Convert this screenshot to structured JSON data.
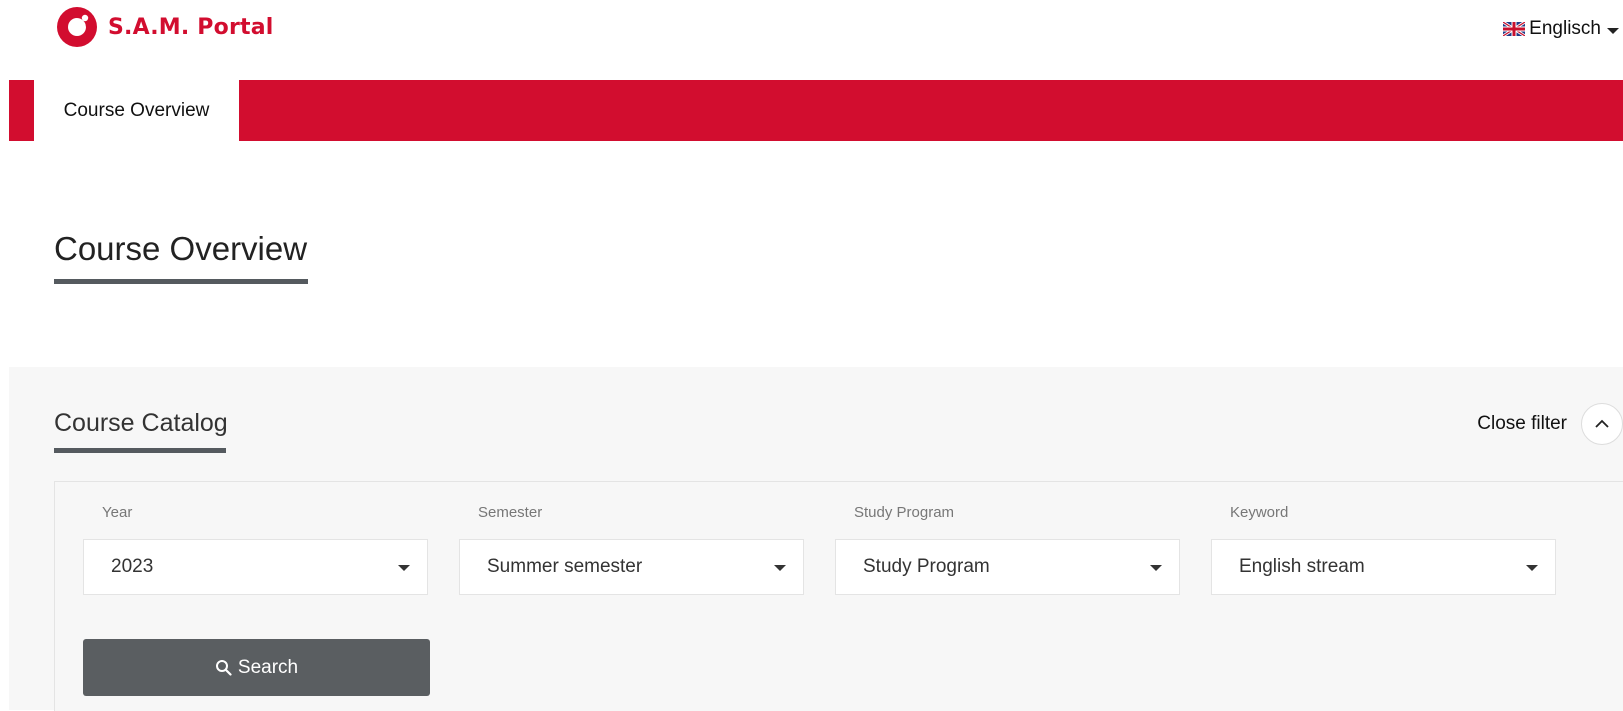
{
  "header": {
    "logo_text": "S.A.M. Portal",
    "language": "Englisch"
  },
  "nav": {
    "tabs": [
      {
        "label": "Course Overview",
        "active": true
      }
    ]
  },
  "page": {
    "title": "Course Overview"
  },
  "filter": {
    "section_title": "Course Catalog",
    "close_label": "Close filter",
    "fields": [
      {
        "label": "Year",
        "value": "2023"
      },
      {
        "label": "Semester",
        "value": "Summer semester"
      },
      {
        "label": "Study Program",
        "value": "Study Program"
      },
      {
        "label": "Keyword",
        "value": "English stream"
      }
    ],
    "search_label": "Search"
  },
  "colors": {
    "brand_red": "#d20d2f",
    "button_gray": "#5a5e61",
    "panel_bg": "#f7f7f7"
  },
  "icons": {
    "logo": "sam-logo-icon",
    "flag": "uk-flag-icon",
    "close": "chevron-up-icon",
    "search": "search-icon"
  }
}
